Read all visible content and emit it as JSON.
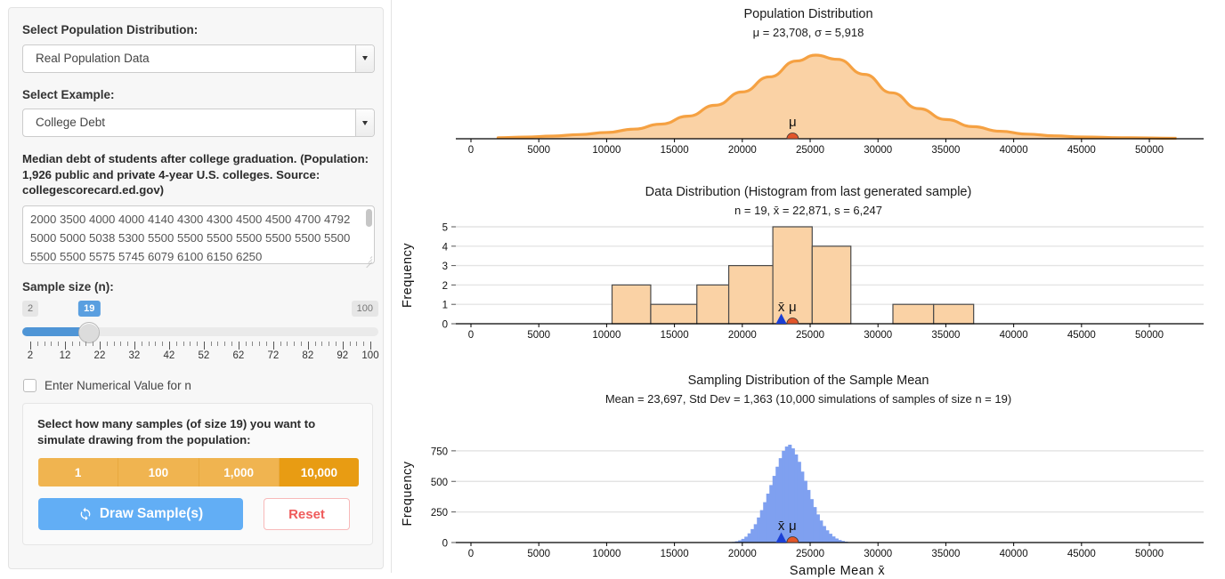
{
  "sidebar": {
    "population_label": "Select Population Distribution:",
    "population_value": "Real Population Data",
    "example_label": "Select Example:",
    "example_value": "College Debt",
    "description": "Median debt of students after college graduation. (Population: 1,926 public and private 4-year U.S. colleges. Source: collegescorecard.ed.gov)",
    "data_text": "2000 3500 4000 4000 4140 4300 4300 4500 4500 4700 4792 5000 5000 5038 5300 5500 5500 5500 5500 5500 5500 5500 5500 5500 5575 5745 6079 6100 6150 6250",
    "sample_size_label": "Sample size (n):",
    "slider": {
      "min_label": "2",
      "max_label": "100",
      "current_label": "19",
      "min": 2,
      "max": 100,
      "value": 19,
      "tick_labels": [
        "2",
        "12",
        "22",
        "32",
        "42",
        "52",
        "62",
        "72",
        "82",
        "92",
        "100"
      ],
      "tick_values": [
        2,
        12,
        22,
        32,
        42,
        52,
        62,
        72,
        82,
        92,
        100
      ]
    },
    "numeric_checkbox_label": "Enter Numerical Value for n",
    "numeric_checkbox_checked": false,
    "sim_question": "Select how many samples (of size 19) you want to simulate drawing from the population:",
    "sim_options": [
      "1",
      "100",
      "1,000",
      "10,000"
    ],
    "sim_selected": "10,000",
    "draw_button_label": "Draw Sample(s)",
    "draw_button_icon": "refresh-icon",
    "reset_button_label": "Reset"
  },
  "colors": {
    "orange_fill": "#fad2a5",
    "orange_stroke": "#f5a142",
    "mu_marker": "#e2552a",
    "xbar_marker": "#1b3fd4",
    "blue_bar": "#7fa0f0",
    "accent_blue": "#62aef5",
    "accent_orange": "#e89c13",
    "reset_red": "#ef5b5b"
  },
  "chart_data": [
    {
      "type": "area",
      "title": "Population Distribution",
      "subtitle": "μ = 23,708, σ = 5,918",
      "mu": 23708,
      "sigma": 5918,
      "xlabel": "",
      "ylabel": "",
      "xlim": [
        0,
        54000
      ],
      "xticks": [
        0,
        5000,
        10000,
        15000,
        20000,
        25000,
        30000,
        35000,
        40000,
        45000,
        50000
      ],
      "xticklabels": [
        "0",
        "5000",
        "10000",
        "15000",
        "20000",
        "25000",
        "30000",
        "35000",
        "40000",
        "45000",
        "50000"
      ],
      "grid": false,
      "markers": [
        {
          "label": "μ",
          "x": 23708,
          "color": "#e2552a",
          "shape": "circle"
        }
      ],
      "density_x": [
        2000,
        4000,
        6000,
        8000,
        10000,
        12000,
        14000,
        16000,
        18000,
        20000,
        22000,
        24000,
        25400,
        27000,
        29000,
        31000,
        33000,
        35000,
        37000,
        39000,
        41000,
        43000,
        45000,
        48000,
        52000
      ],
      "density_y": [
        0.012,
        0.02,
        0.032,
        0.05,
        0.075,
        0.115,
        0.175,
        0.27,
        0.4,
        0.56,
        0.74,
        0.93,
        1.0,
        0.95,
        0.77,
        0.55,
        0.36,
        0.23,
        0.145,
        0.09,
        0.055,
        0.035,
        0.022,
        0.012,
        0.006
      ]
    },
    {
      "type": "bar",
      "title": "Data Distribution (Histogram from last generated sample)",
      "subtitle": "n = 19,  x̄ = 22,871,  s = 6,247",
      "n": 19,
      "xbar": 22871,
      "s": 6247,
      "xlabel": "",
      "ylabel": "Frequency",
      "xlim": [
        0,
        54000
      ],
      "ylim": [
        0,
        5
      ],
      "yticks": [
        0,
        1,
        2,
        3,
        4,
        5
      ],
      "yticklabels": [
        "0",
        "1",
        "2",
        "3",
        "4",
        "5"
      ],
      "xticks": [
        0,
        5000,
        10000,
        15000,
        20000,
        25000,
        30000,
        35000,
        40000,
        45000,
        50000
      ],
      "xticklabels": [
        "0",
        "5000",
        "10000",
        "15000",
        "20000",
        "25000",
        "30000",
        "35000",
        "40000",
        "45000",
        "50000"
      ],
      "grid": true,
      "bins": [
        {
          "x0": 10400,
          "x1": 13250,
          "count": 2
        },
        {
          "x0": 13250,
          "x1": 16650,
          "count": 1
        },
        {
          "x0": 16650,
          "x1": 19000,
          "count": 2
        },
        {
          "x0": 19000,
          "x1": 22250,
          "count": 3
        },
        {
          "x0": 22250,
          "x1": 25150,
          "count": 5
        },
        {
          "x0": 25150,
          "x1": 28000,
          "count": 4
        },
        {
          "x0": 31100,
          "x1": 34100,
          "count": 1
        },
        {
          "x0": 34100,
          "x1": 37050,
          "count": 1
        }
      ],
      "markers": [
        {
          "label": "x̄",
          "x": 22871,
          "color": "#1b3fd4",
          "shape": "triangle"
        },
        {
          "label": "μ",
          "x": 23708,
          "color": "#e2552a",
          "shape": "circle"
        }
      ]
    },
    {
      "type": "bar",
      "title": "Sampling Distribution of the Sample Mean",
      "subtitle": "Mean = 23,697, Std Dev = 1,363  (10,000 simulations of samples of size n = 19)",
      "mean": 23697,
      "std_dev": 1363,
      "simulations": 10000,
      "sample_size": 19,
      "xlabel": "Sample Mean x̄",
      "ylabel": "Frequency",
      "xlim": [
        0,
        54000
      ],
      "ylim": [
        0,
        800
      ],
      "yticks": [
        0,
        250,
        500,
        750
      ],
      "yticklabels": [
        "0",
        "250",
        "500",
        "750"
      ],
      "xticks": [
        0,
        5000,
        10000,
        15000,
        20000,
        25000,
        30000,
        35000,
        40000,
        45000,
        50000
      ],
      "xticklabels": [
        "0",
        "5000",
        "10000",
        "15000",
        "20000",
        "25000",
        "30000",
        "35000",
        "40000",
        "45000",
        "50000"
      ],
      "grid": true,
      "bin_width": 230,
      "bins_x": [
        19350,
        19580,
        19810,
        20040,
        20270,
        20500,
        20730,
        20960,
        21190,
        21420,
        21650,
        21880,
        22110,
        22340,
        22570,
        22800,
        23030,
        23260,
        23490,
        23720,
        23950,
        24180,
        24410,
        24640,
        24870,
        25100,
        25330,
        25560,
        25790,
        26020,
        26250,
        26480,
        26710,
        26940,
        27170,
        27400,
        27630,
        27860
      ],
      "bins_y": [
        5,
        10,
        18,
        30,
        48,
        75,
        110,
        150,
        205,
        265,
        330,
        400,
        470,
        545,
        620,
        690,
        750,
        785,
        800,
        770,
        720,
        660,
        580,
        505,
        430,
        355,
        290,
        230,
        180,
        135,
        100,
        72,
        50,
        33,
        21,
        13,
        7,
        3
      ],
      "markers": [
        {
          "label": "x̄",
          "x": 22871,
          "color": "#1b3fd4",
          "shape": "triangle"
        },
        {
          "label": "μ",
          "x": 23708,
          "color": "#e2552a",
          "shape": "circle"
        }
      ]
    }
  ]
}
